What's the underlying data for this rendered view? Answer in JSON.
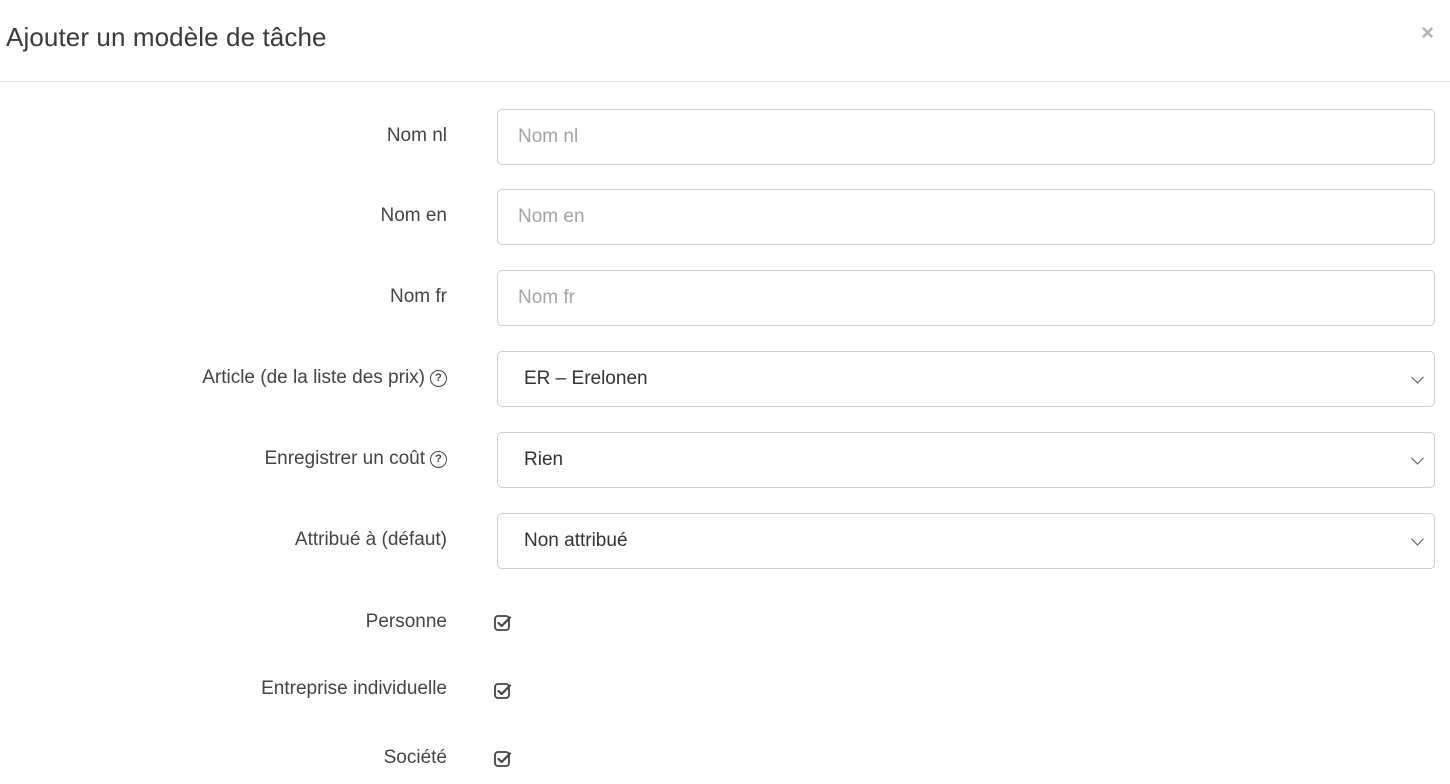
{
  "modal": {
    "title": "Ajouter un modèle de tâche",
    "close_symbol": "×"
  },
  "fields": {
    "nom_nl": {
      "label": "Nom nl",
      "value": "",
      "placeholder": "Nom nl"
    },
    "nom_en": {
      "label": "Nom en",
      "value": "",
      "placeholder": "Nom en"
    },
    "nom_fr": {
      "label": "Nom fr",
      "value": "",
      "placeholder": "Nom fr"
    },
    "article": {
      "label": "Article (de la liste des prix)",
      "selected": "ER – Erelonen",
      "help_icon": "question-circle-icon"
    },
    "cost": {
      "label": "Enregistrer un coût",
      "selected": "Rien",
      "help_icon": "question-circle-icon"
    },
    "assigned": {
      "label": "Attribué à (défaut)",
      "selected": "Non attribué"
    },
    "personne": {
      "label": "Personne",
      "checked": true,
      "icon": "check-square-icon"
    },
    "entreprise": {
      "label": "Entreprise individuelle",
      "checked": true,
      "icon": "check-square-icon"
    },
    "societe": {
      "label": "Société",
      "checked": true,
      "icon": "check-square-icon"
    }
  },
  "colors": {
    "border": "#cfcfcf",
    "label": "#444444",
    "placeholder": "#a4a4a4",
    "close": "#b4b4b4"
  }
}
